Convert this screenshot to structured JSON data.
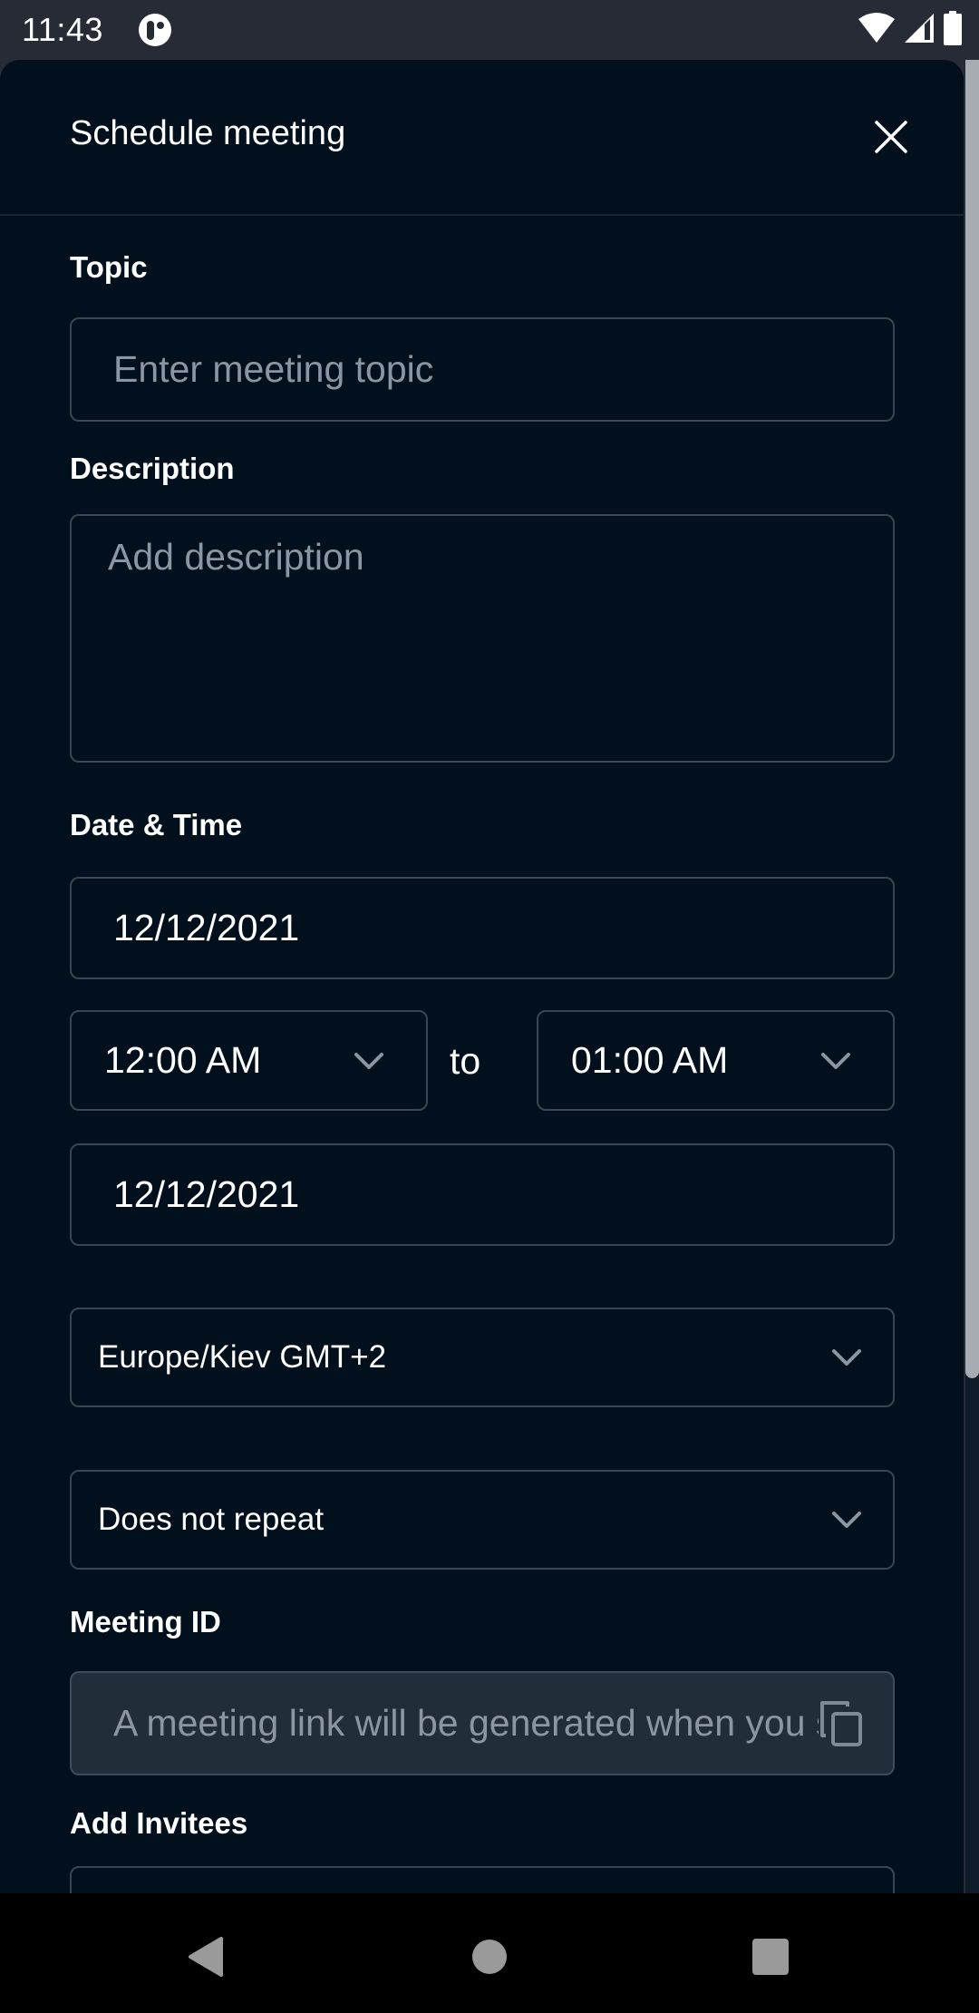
{
  "status_bar": {
    "time": "11:43",
    "app_icon": "notification-app-icon",
    "icons": [
      "wifi-icon",
      "cellular-signal-icon",
      "battery-icon"
    ]
  },
  "dialog": {
    "title": "Schedule meeting",
    "close_icon": "close-icon"
  },
  "form": {
    "topic": {
      "label": "Topic",
      "placeholder": "Enter meeting topic",
      "value": ""
    },
    "description": {
      "label": "Description",
      "placeholder": "Add description",
      "value": ""
    },
    "date_time": {
      "label": "Date & Time",
      "start_date": "12/12/2021",
      "start_time": "12:00 AM",
      "separator": "to",
      "end_time": "01:00 AM",
      "end_date": "12/12/2021"
    },
    "timezone": {
      "value": "Europe/Kiev GMT+2"
    },
    "repeat": {
      "value": "Does not repeat"
    },
    "meeting_id": {
      "label": "Meeting ID",
      "placeholder": "A meeting link will be generated when you save",
      "copy_icon": "copy-icon"
    },
    "invitees": {
      "label": "Add Invitees",
      "value": ""
    }
  },
  "colors": {
    "sheet_bg": "#02101e",
    "status_bar_bg": "#262b35",
    "field_border": "#3a4654",
    "disabled_field_bg": "#222d3a",
    "placeholder_text": "#8c96a2",
    "text": "#ffffff"
  },
  "nav_bar": {
    "buttons": [
      "back-icon",
      "home-icon",
      "recents-icon"
    ]
  }
}
